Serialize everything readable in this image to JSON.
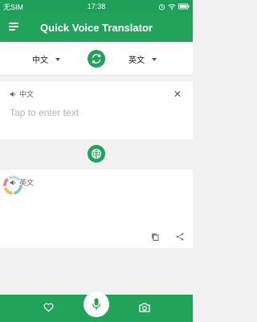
{
  "status_bar": {
    "carrier": "无SIM",
    "time": "17:38",
    "icons": [
      "alarm-icon",
      "wifi-icon",
      "battery-icon"
    ]
  },
  "app_bar": {
    "title": "Quick Voice Translator",
    "menu_icon": "hamburger-menu-icon"
  },
  "language_bar": {
    "source_language": "中文",
    "target_language": "英文",
    "swap_icon": "swap-icon"
  },
  "input_card": {
    "language": "中文",
    "placeholder": "Tap to enter text",
    "speaker_icon": "speaker-icon",
    "clear_icon": "close-icon"
  },
  "translate_button_icon": "globe-icon",
  "output_card": {
    "language": "英文",
    "speaker_icon": "speaker-icon",
    "copy_icon": "copy-icon",
    "share_icon": "share-icon"
  },
  "bottom_bar": {
    "favorites_icon": "heart-icon",
    "mic_icon": "microphone-icon",
    "camera_icon": "camera-icon"
  },
  "colors": {
    "primary": "#21a35c",
    "status_bar": "#1fa05a",
    "placeholder": "#b5b5b5"
  }
}
